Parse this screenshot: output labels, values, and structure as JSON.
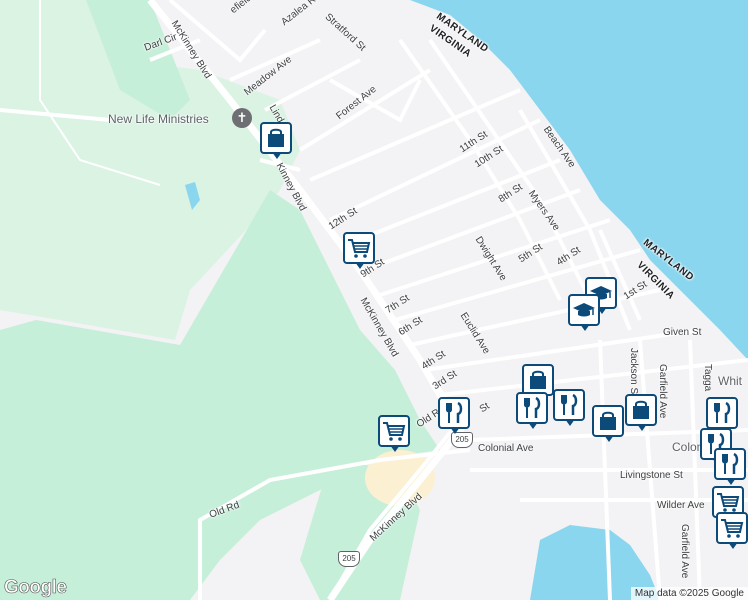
{
  "map": {
    "attribution": "Map data ©2025 Google",
    "logo": "Google",
    "colors": {
      "water": "#8ad6ee",
      "green": "#c6efd9",
      "lightgreen": "#daf3e3",
      "land": "#f3f2f4",
      "road": "#ffffff",
      "major_road": "#ffffff",
      "pin_border": "#0c4a7a",
      "sand": "#fbf1d2"
    }
  },
  "places": {
    "church": "New Life Ministries",
    "church_icon": "cross-icon"
  },
  "states": {
    "maryland_top": "MARYLAND",
    "virginia_top": "VIRGINIA",
    "maryland_right": "MARYLAND",
    "virginia_right": "VIRGINIA"
  },
  "streets": {
    "darl_cir": "Darl Cir",
    "mckinney_top": "McKinney Blvd",
    "mckinney_mid_a": "Kinney Blvd",
    "mckinney_mid_b": "McKinney Blvd",
    "mckinney_bottom": "McKinney Blvd",
    "azalea": "Azalea Rd",
    "stratford": "Stratford St",
    "fairfield": "efield St",
    "meadow": "Meadow Ave",
    "linda": "Linda L",
    "forest": "Forest Ave",
    "s11": "11th St",
    "s10": "10th St",
    "beach": "Beach Ave",
    "s12": "12th St",
    "s8": "8th St",
    "myers": "Myers Ave",
    "s9": "9th St",
    "dwight": "Dwight Ave",
    "s5": "5th St",
    "s4": "4th St",
    "s7": "7th St",
    "s6": "6th St",
    "s4b": "4th St",
    "s3": "3rd St",
    "euclid": "Euclid Ave",
    "s1": "1st St",
    "given": "Given St",
    "jackson": "Jackson S",
    "garfield": "Garfield Ave",
    "tagga": "Tagga",
    "white": "Whit",
    "colonial": "Colonial Ave",
    "colonial_b": "Colon",
    "beach_suffix": "Be",
    "livingstone": "Livingstone St",
    "wilder": "Wilder Ave",
    "garfield2": "Garfield Ave",
    "old": "Old Rd",
    "old2": "Old Rd",
    "st_end": "St",
    "route": "205",
    "route2": "205"
  },
  "markers": [
    {
      "icon": "shopping-bag-icon"
    },
    {
      "icon": "shopping-cart-icon"
    },
    {
      "icon": "school-icon"
    },
    {
      "icon": "school-icon"
    },
    {
      "icon": "shopping-bag-icon"
    },
    {
      "icon": "restaurant-icon"
    },
    {
      "icon": "restaurant-icon"
    },
    {
      "icon": "restaurant-icon"
    },
    {
      "icon": "shopping-bag-icon"
    },
    {
      "icon": "shopping-bag-icon"
    },
    {
      "icon": "shopping-cart-icon"
    },
    {
      "icon": "restaurant-icon"
    },
    {
      "icon": "restaurant-icon"
    },
    {
      "icon": "restaurant-icon"
    },
    {
      "icon": "shopping-cart-icon"
    },
    {
      "icon": "shopping-cart-icon"
    }
  ]
}
